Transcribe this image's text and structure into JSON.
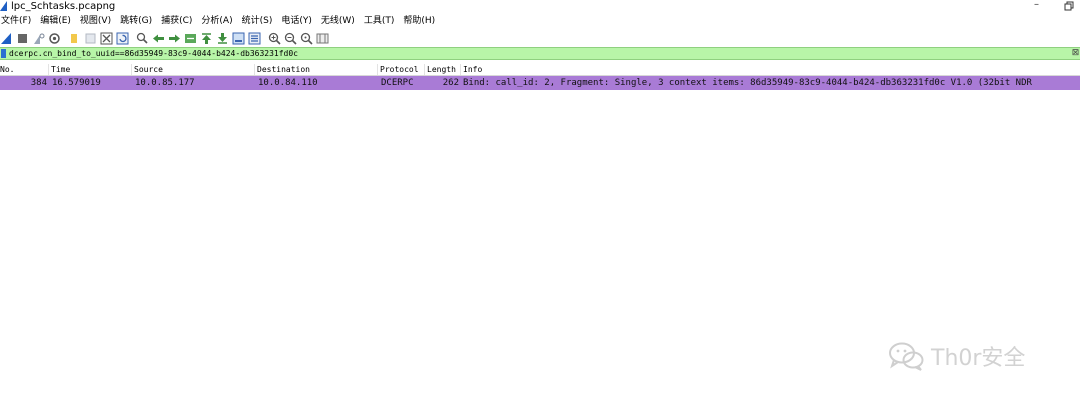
{
  "window": {
    "title": "lpc_Schtasks.pcapng",
    "minimize_glyph": "–",
    "restore_glyph": "❐"
  },
  "menu": [
    "文件(F)",
    "编辑(E)",
    "视图(V)",
    "跳转(G)",
    "捕获(C)",
    "分析(A)",
    "统计(S)",
    "电话(Y)",
    "无线(W)",
    "工具(T)",
    "帮助(H)"
  ],
  "toolbar": {
    "icons": [
      "start-capture-icon",
      "stop-capture-icon",
      "restart-capture-icon",
      "capture-options-icon",
      "open-file-icon",
      "save-file-icon",
      "close-file-icon",
      "reload-file-icon",
      "find-packet-icon",
      "go-back-icon",
      "go-forward-icon",
      "go-to-packet-icon",
      "go-first-icon",
      "go-last-icon",
      "auto-scroll-icon",
      "colorize-icon",
      "zoom-in-icon",
      "zoom-out-icon",
      "normal-size-icon",
      "resize-columns-icon"
    ]
  },
  "filter": {
    "value": "dcerpc.cn_bind_to_uuid==86d35949-83c9-4044-b424-db363231fd0c",
    "clear_glyph": "⊠",
    "accent": "#b8f5a8"
  },
  "columns": [
    "No.",
    "Time",
    "Source",
    "Destination",
    "Protocol",
    "Length",
    "Info"
  ],
  "packets": [
    {
      "no": "384",
      "time": "16.579019",
      "source": "10.0.85.177",
      "destination": "10.0.84.110",
      "protocol": "DCERPC",
      "length": "262",
      "info": "Bind: call_id: 2, Fragment: Single, 3 context items: 86d35949-83c9-4044-b424-db363231fd0c V1.0 (32bit NDR",
      "row_color": "#a97bd6"
    }
  ],
  "watermark": {
    "text": "Th0r安全"
  }
}
